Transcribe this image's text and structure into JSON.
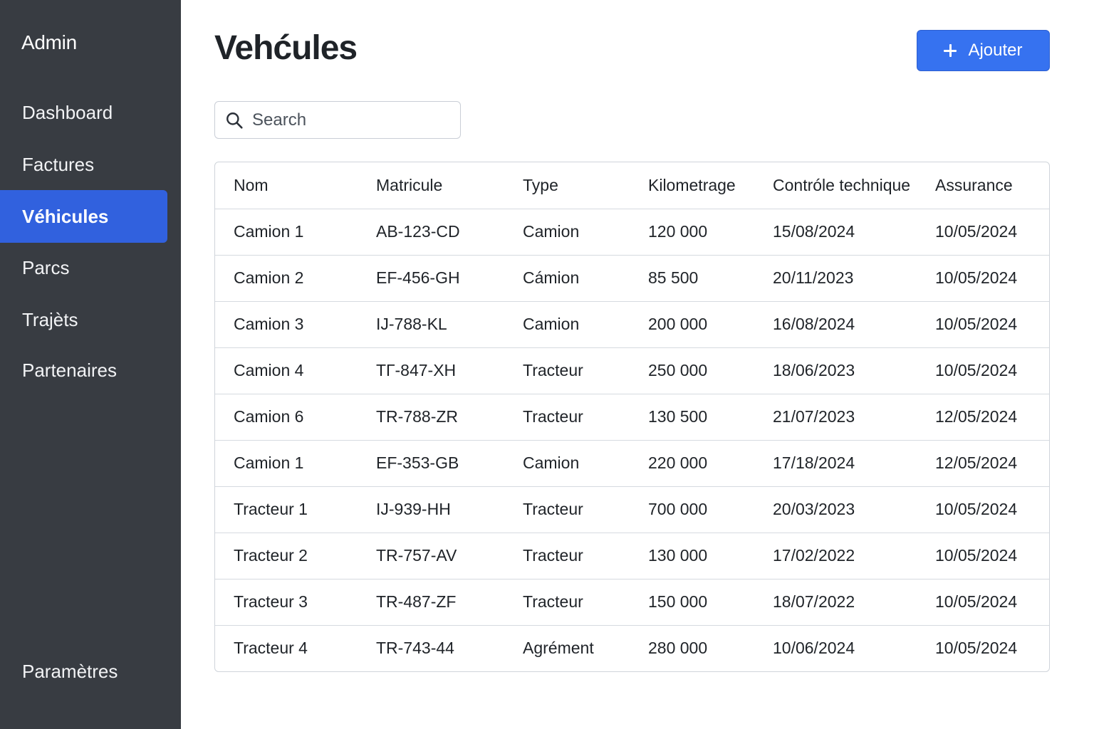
{
  "sidebar": {
    "brand": "Admin",
    "items": [
      {
        "label": "Dashboard"
      },
      {
        "label": "Factures"
      },
      {
        "label": "Véhicules",
        "active": true
      },
      {
        "label": "Parcs"
      },
      {
        "label": "Trajèts"
      },
      {
        "label": "Partenaires"
      }
    ],
    "settings_label": "Paramètres",
    "colors": {
      "background": "#383c42",
      "active": "#3161de"
    }
  },
  "header": {
    "title": "Vehćules",
    "add_label": "Ajouter",
    "add_icon": "plus-icon",
    "accent_color": "#3672f0"
  },
  "search": {
    "placeholder": "Search",
    "value": "",
    "icon": "search-icon"
  },
  "table": {
    "columns": [
      "Nom",
      "Matricule",
      "Type",
      "Kilometrage",
      "Contróle technique",
      "Assurance"
    ],
    "rows": [
      [
        "Camion 1",
        "AB-123-CD",
        "Camion",
        "120 000",
        "15/08/2024",
        "10/05/2024"
      ],
      [
        "Camion 2",
        "EF-456-GH",
        "Cámion",
        "85 500",
        "20/11/2023",
        "10/05/2024"
      ],
      [
        "Camion 3",
        "IJ-788-KL",
        "Camion",
        "200 000",
        "16/08/2024",
        "10/05/2024"
      ],
      [
        "Camion 4",
        "TГ-847-XH",
        "Tracteur",
        "250 000",
        "18/06/2023",
        "10/05/2024"
      ],
      [
        "Camion 6",
        "TR-788-ZR",
        "Tracteur",
        "130 500",
        "21/07/2023",
        "12/05/2024"
      ],
      [
        "Camion 1",
        "EF-353-GB",
        "Camion",
        "220 000",
        "17/18/2024",
        "12/05/2024"
      ],
      [
        "Tracteur 1",
        "IJ-939-HH",
        "Tracteur",
        "700 000",
        "20/03/2023",
        "10/05/2024"
      ],
      [
        "Tracteur 2",
        "TR-757-AV",
        "Tracteur",
        "130 000",
        "17/02/2022",
        "10/05/2024"
      ],
      [
        "Tracteur 3",
        "TR-487-ZF",
        "Tracteur",
        "150 000",
        "18/07/2022",
        "10/05/2024"
      ],
      [
        "Tracteur 4",
        "TR-743-44",
        "Agrément",
        "280 000",
        "10/06/2024",
        "10/05/2024"
      ]
    ]
  }
}
